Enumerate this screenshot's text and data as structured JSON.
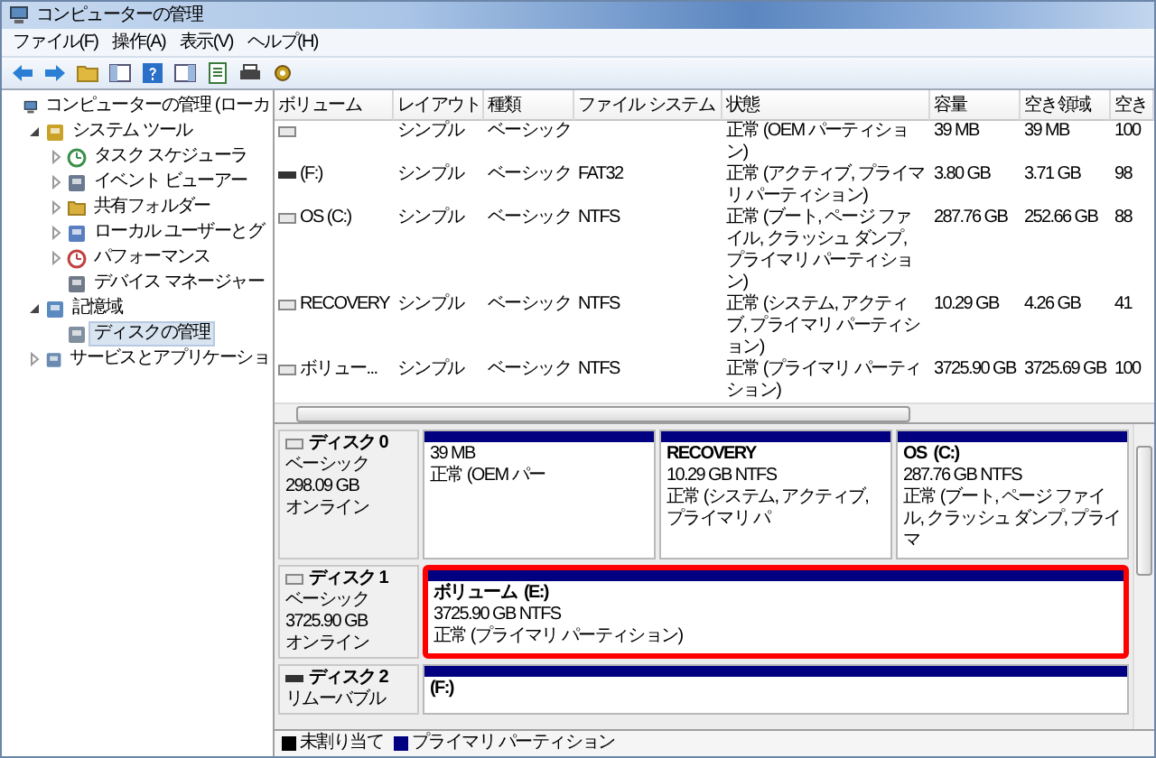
{
  "window": {
    "title": "コンピューターの管理"
  },
  "menu": [
    "ファイル(F)",
    "操作(A)",
    "表示(V)",
    "ヘルプ(H)"
  ],
  "tree": [
    {
      "label": "コンピューターの管理 (ローカ",
      "kind": "computer",
      "selected": false,
      "children": [
        {
          "label": "システム ツール",
          "kind": "tools",
          "expanded": true,
          "selected": false,
          "children": [
            {
              "label": "タスク スケジューラ",
              "kind": "clock",
              "expanded": false,
              "selected": false
            },
            {
              "label": "イベント ビューアー",
              "kind": "log",
              "expanded": false,
              "selected": false
            },
            {
              "label": "共有フォルダー",
              "kind": "folder",
              "expanded": false,
              "selected": false
            },
            {
              "label": "ローカル ユーザーとグ",
              "kind": "users",
              "expanded": false,
              "selected": false
            },
            {
              "label": "パフォーマンス",
              "kind": "gauge",
              "expanded": false,
              "selected": false
            },
            {
              "label": "デバイス マネージャー",
              "kind": "device",
              "selected": false
            }
          ]
        },
        {
          "label": "記憶域",
          "kind": "storage",
          "expanded": true,
          "selected": false,
          "children": [
            {
              "label": "ディスクの管理",
              "kind": "disk",
              "selected": true
            }
          ]
        },
        {
          "label": "サービスとアプリケーショ",
          "kind": "services",
          "expanded": false,
          "selected": false
        }
      ]
    }
  ],
  "table": {
    "columns": [
      "ボリューム",
      "レイアウト",
      "種類",
      "ファイル システム",
      "状態",
      "容量",
      "空き領域",
      "空き"
    ],
    "rows": [
      {
        "kind": "disk",
        "cells": [
          null,
          "シンプル",
          "ベーシック",
          null,
          "正常 (OEM パーティション)",
          "39 MB",
          "39 MB",
          "100"
        ]
      },
      {
        "kind": "removable",
        "cells": [
          "(F:)",
          "シンプル",
          "ベーシック",
          "FAT32",
          "正常 (アクティブ, プライマリ パーティション)",
          "3.80 GB",
          "3.71 GB",
          "98"
        ]
      },
      {
        "kind": "disk",
        "cells": [
          "OS (C:)",
          "シンプル",
          "ベーシック",
          "NTFS",
          "正常 (ブート, ページ ファイル, クラッシュ ダンプ, プライマリ パーティション)",
          "287.76 GB",
          "252.66 GB",
          "88"
        ]
      },
      {
        "kind": "disk",
        "cells": [
          "RECOVERY",
          "シンプル",
          "ベーシック",
          "NTFS",
          "正常 (システム, アクティブ, プライマリ パーティション)",
          "10.29 GB",
          "4.26 GB",
          "41"
        ]
      },
      {
        "kind": "disk",
        "cells": [
          "ボリュー...",
          "シンプル",
          "ベーシック",
          "NTFS",
          "正常 (プライマリ パーティション)",
          "3725.90 GB",
          "3725.69 GB",
          "100"
        ]
      }
    ]
  },
  "disks": [
    {
      "name": "ディスク 0",
      "kind": "disk",
      "info": [
        "ベーシック",
        "298.09 GB",
        "オンライン"
      ],
      "partitions": [
        {
          "size": "39 MB",
          "status": "正常 (OEM パー",
          "highlighted": false
        },
        {
          "name": "RECOVERY",
          "size": "10.29 GB NTFS",
          "status": "正常 (システム, アクティブ, プライマリ パ",
          "highlighted": false
        },
        {
          "name": "OS  (C:)",
          "size": "287.76 GB NTFS",
          "status": "正常 (ブート, ページ ファイル, クラッシュ ダンプ, プライマ",
          "highlighted": false
        }
      ]
    },
    {
      "name": "ディスク 1",
      "kind": "disk",
      "info": [
        "ベーシック",
        "3725.90 GB",
        "オンライン"
      ],
      "partitions": [
        {
          "name": "ボリューム  (E:)",
          "size": "3725.90 GB NTFS",
          "status": "正常 (プライマリ パーティション)",
          "highlighted": true
        }
      ]
    },
    {
      "name": "ディスク 2",
      "kind": "removable",
      "info": [
        "リムーバブル"
      ],
      "partitions": [
        {
          "name": "(F:)",
          "highlighted": false
        }
      ]
    }
  ],
  "legend": [
    {
      "label": "未割り当て",
      "color": "#000000"
    },
    {
      "label": "プライマリ パーティション",
      "color": "#000080"
    }
  ]
}
